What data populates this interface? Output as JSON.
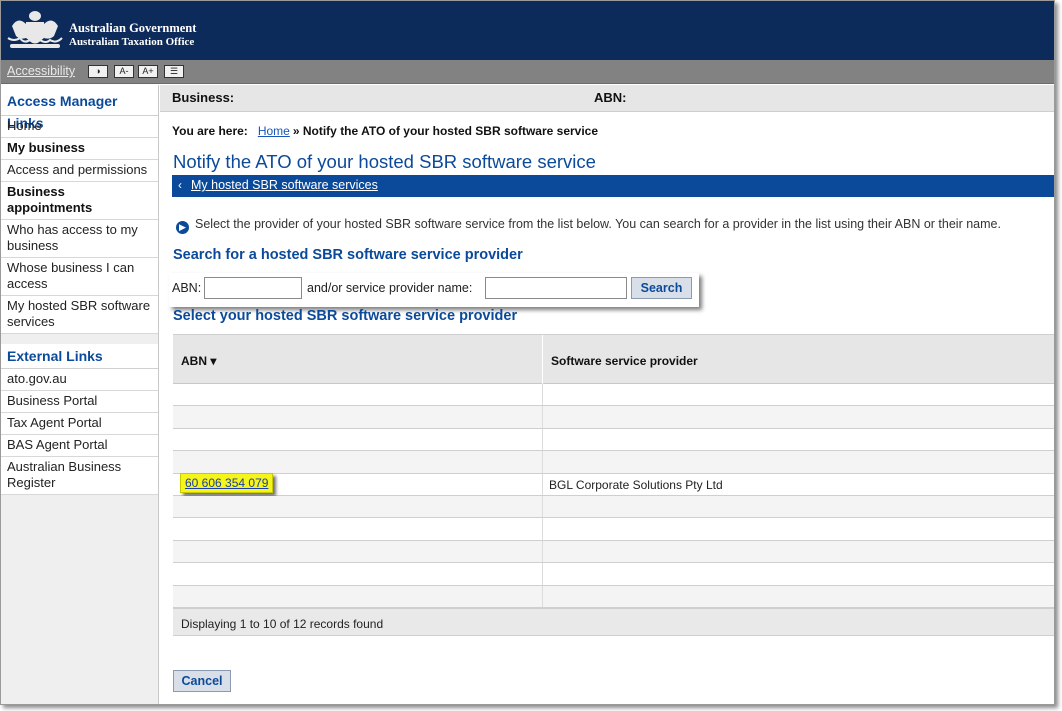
{
  "header": {
    "gov_line1": "Australian Government",
    "gov_line2": "Australian Taxation Office",
    "brand_color": "#0c2a5a"
  },
  "access_bar": {
    "link": "Accessibility",
    "contrast_icon": "contrast-icon",
    "decrease_text": "A-",
    "increase_text": "A+",
    "layout_icon": "layout-icon"
  },
  "sidebar": {
    "section1_title": "Access Manager Links",
    "items": [
      {
        "label": "Home",
        "bold": false
      },
      {
        "label": "My business",
        "bold": true
      },
      {
        "label": "Access and permissions",
        "bold": false
      },
      {
        "label": "Business appointments",
        "bold": true
      },
      {
        "label": "Who has access to my business",
        "bold": false
      },
      {
        "label": "Whose business I can access",
        "bold": false
      },
      {
        "label": "My hosted SBR software services",
        "bold": false
      }
    ],
    "section2_title": "External Links",
    "external": [
      {
        "label": "ato.gov.au"
      },
      {
        "label": "Business Portal"
      },
      {
        "label": "Tax Agent Portal"
      },
      {
        "label": "BAS Agent Portal"
      },
      {
        "label": "Australian Business Register"
      }
    ]
  },
  "business_bar": {
    "business_label": "Business:",
    "abn_label": "ABN:"
  },
  "breadcrumb": {
    "prefix": "You are here:",
    "home": "Home",
    "separator": "»",
    "current": "Notify the ATO of your hosted SBR software service"
  },
  "page_title": "Notify the ATO of your hosted SBR software service",
  "back_link": "My hosted SBR software services",
  "info_text": "Select the provider of your hosted SBR software service from the list below. You can search for a provider in the list using their ABN or their name.",
  "search": {
    "heading": "Search for a hosted SBR software service provider",
    "abn_label": "ABN:",
    "abn_value": "",
    "name_label": "and/or service provider name:",
    "name_value": "",
    "button": "Search"
  },
  "results": {
    "heading": "Select your hosted SBR software service provider",
    "col_abn": "ABN",
    "col_provider": "Software service provider",
    "rows": [
      {
        "abn": "",
        "provider": ""
      },
      {
        "abn": "",
        "provider": ""
      },
      {
        "abn": "",
        "provider": ""
      },
      {
        "abn": "",
        "provider": ""
      },
      {
        "abn": "60 606 354 079",
        "provider": "BGL Corporate Solutions Pty Ltd"
      },
      {
        "abn": "",
        "provider": ""
      },
      {
        "abn": "",
        "provider": ""
      },
      {
        "abn": "",
        "provider": ""
      },
      {
        "abn": "",
        "provider": ""
      },
      {
        "abn": "",
        "provider": ""
      }
    ],
    "footer": "Displaying 1 to 10 of 12 records found"
  },
  "cancel_button": "Cancel"
}
